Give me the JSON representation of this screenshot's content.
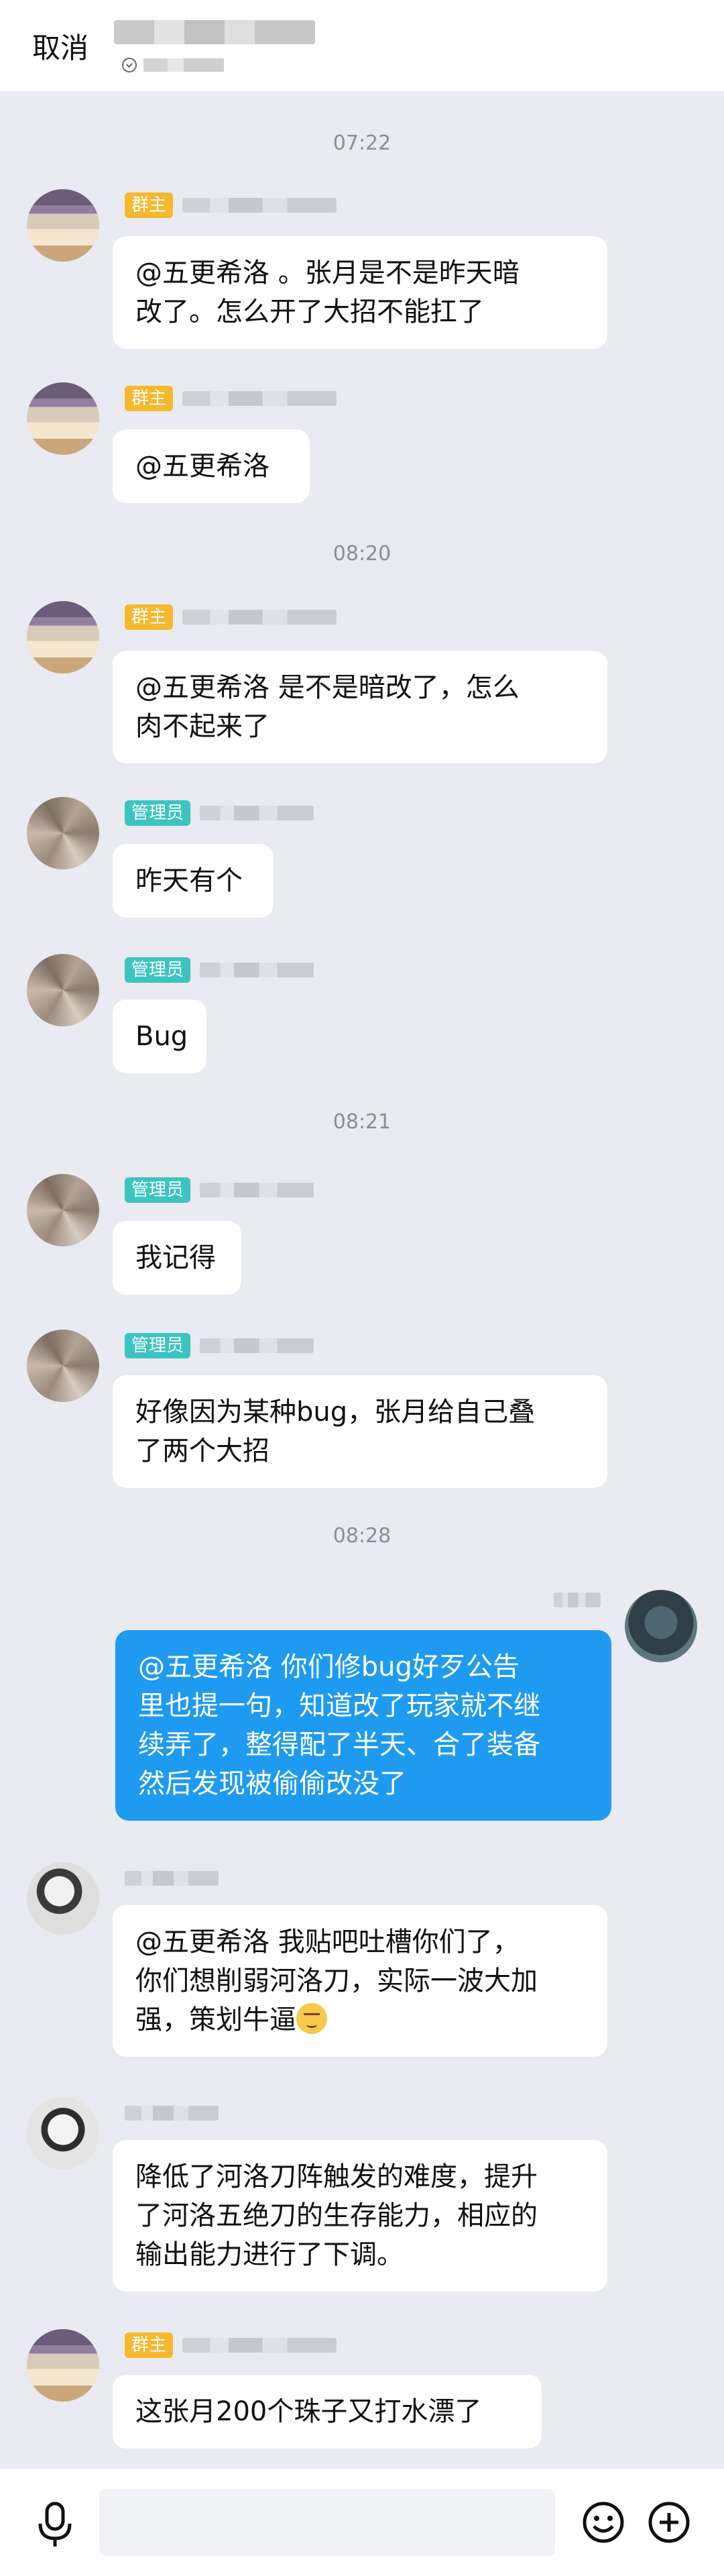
{
  "header": {
    "cancel_label": "取消"
  },
  "times": [
    "07:22",
    "08:20",
    "08:21",
    "08:28"
  ],
  "badges": {
    "owner": "群主",
    "admin": "管理员"
  },
  "messages": [
    {
      "text_lines": [
        "@五更希洛 。张月是不是昨天暗",
        "改了。怎么开了大招不能扛了"
      ]
    },
    {
      "text_lines": [
        "@五更希洛"
      ]
    },
    {
      "text_lines": [
        "@五更希洛 是不是暗改了，怎么",
        "肉不起来了"
      ]
    },
    {
      "text_lines": [
        "昨天有个"
      ]
    },
    {
      "text_lines": [
        "Bug"
      ]
    },
    {
      "text_lines": [
        "我记得"
      ]
    },
    {
      "text_lines": [
        "好像因为某种bug，张月给自己叠",
        "了两个大招"
      ]
    },
    {
      "text_lines": [
        "@五更希洛 你们修bug好歹公告",
        "里也提一句，知道改了玩家就不继",
        "续弄了，整得配了半天、合了装备",
        "然后发现被偷偷改没了"
      ]
    },
    {
      "text_lines": [
        "@五更希洛 我贴吧吐槽你们了，",
        "你们想削弱河洛刀，实际一波大加",
        "强，策划牛逼"
      ]
    },
    {
      "text_lines": [
        "降低了河洛刀阵触发的难度，提升",
        "了河洛五绝刀的生存能力，相应的",
        "输出能力进行了下调。"
      ]
    },
    {
      "text_lines": [
        "这张月200个珠子又打水漂了"
      ]
    }
  ],
  "icons": {
    "mic": "microphone-icon",
    "emoji": "smiley-icon",
    "plus": "plus-circle-icon",
    "subtitle": "check-circle-icon"
  },
  "colors": {
    "background": "#e9eaf2",
    "self_bubble": "#1e9bf0",
    "owner_badge": "#f5b82e",
    "admin_badge": "#3cc4c0"
  }
}
